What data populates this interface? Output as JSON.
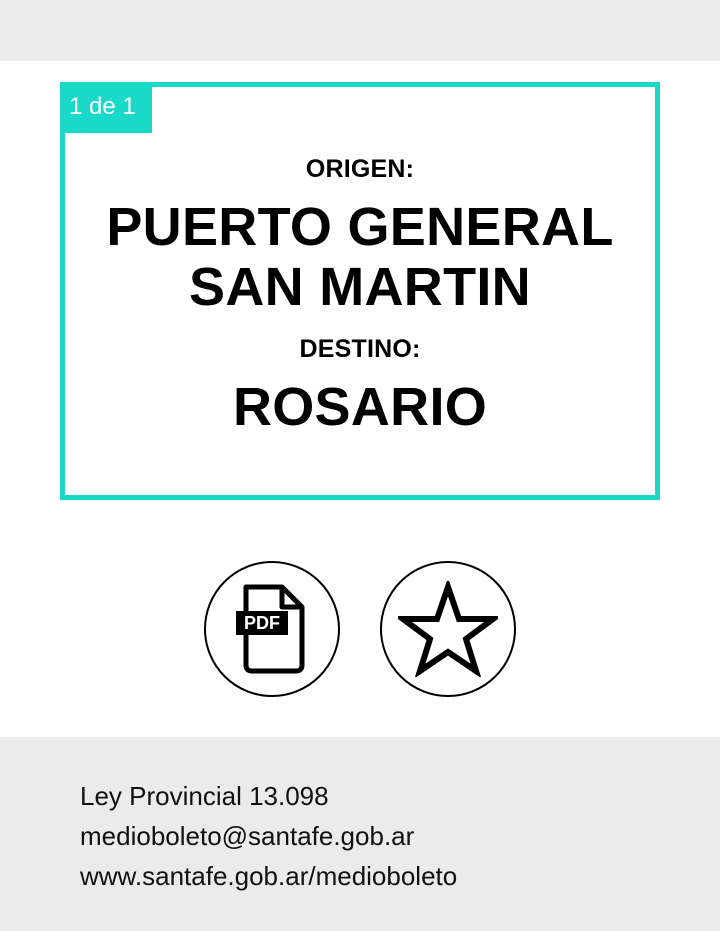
{
  "card": {
    "badge": "1 de 1",
    "origin_label": "ORIGEN:",
    "origin_line1": "PUERTO GENERAL",
    "origin_line2": "SAN MARTIN",
    "destination_label": "DESTINO:",
    "destination": "ROSARIO",
    "accent_color": "#1bd9c9"
  },
  "actions": {
    "pdf_icon": "pdf-file-icon",
    "pdf_icon_text": "PDF",
    "favorite_icon": "star-outline-icon"
  },
  "footer": {
    "law": "Ley Provincial 13.098",
    "email": "medioboleto@santafe.gob.ar",
    "website": "www.santafe.gob.ar/medioboleto",
    "background_color": "#ebebeb"
  }
}
